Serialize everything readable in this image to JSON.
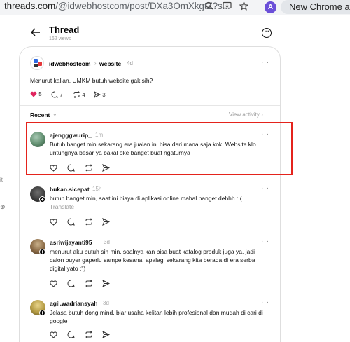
{
  "browser": {
    "url_host": "threads.com",
    "url_path": "/@idwebhostcom/post/DXa3OmXkgtZ?s...",
    "profile_letter": "A",
    "chrome_button": "New Chrome ava"
  },
  "left_remnants": [
    "it",
    "⊕"
  ],
  "header": {
    "title": "Thread",
    "views": "162 views"
  },
  "post": {
    "username": "idwebhostcom",
    "separator": "›",
    "topic": "website",
    "time": "4d",
    "more": "···",
    "text": "Menurut kalian, UMKM butuh website gak sih?",
    "likes": "5",
    "replies": "7",
    "reposts": "4",
    "shares": "3",
    "like_color": "#e0245e"
  },
  "recent": {
    "label": "Recent",
    "chevron": "⌄",
    "view_activity": "View activity ›"
  },
  "replies": [
    {
      "username": "ajengggwurip_",
      "time": "1m",
      "text": "Butuh banget min sekarang era jualan ini bisa dari mana saja kok. Website klo untungnya besar ya bakal oke banget buat ngaturnya",
      "translate": ""
    },
    {
      "username": "bukan.sicepat",
      "time": "15h",
      "text": "butuh banget min, saat ini biaya di aplikasi online mahal banget dehhh : (",
      "translate": "Translate"
    },
    {
      "username": "asriwijayanti95",
      "time": "3d",
      "text": "menurut aku butuh sih min, soalnya kan bisa buat katalog produk juga ya, jadi calon buyer gaperlu sampe kesana. apalagi sekarang kita berada di era serba digital yato :\")",
      "translate": ""
    },
    {
      "username": "agil.wadriansyah",
      "time": "3d",
      "text": "Jelasa butuh dong mind, biar usaha kelitan lebih profesional dan mudah di cari di google",
      "translate": ""
    }
  ],
  "highlight_color": "#e4231c"
}
